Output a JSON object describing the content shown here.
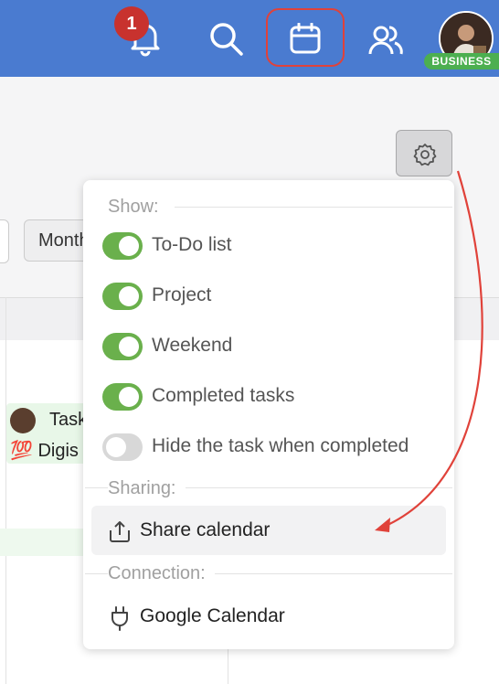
{
  "topbar": {
    "notification_count": "1",
    "avatar_badge": "BUSINESS",
    "bg_color": "#4a7bd0"
  },
  "background": {
    "month_button": "Month",
    "task_title": "Task",
    "task_subtitle": "💯 Digis"
  },
  "settings": {
    "gear_icon": "gear-icon"
  },
  "popover": {
    "show_label": "Show:",
    "toggles": [
      {
        "label": "To-Do list",
        "on": true
      },
      {
        "label": "Project",
        "on": true
      },
      {
        "label": "Weekend",
        "on": true
      },
      {
        "label": "Completed tasks",
        "on": true
      },
      {
        "label": "Hide the task when completed",
        "on": false
      }
    ],
    "sharing_label": "Sharing:",
    "share_calendar": "Share calendar",
    "connection_label": "Connection:",
    "google_calendar": "Google Calendar"
  },
  "colors": {
    "toggle_on": "#6ab04c",
    "toggle_off": "#d8d8d8",
    "highlight": "#e0423a"
  }
}
